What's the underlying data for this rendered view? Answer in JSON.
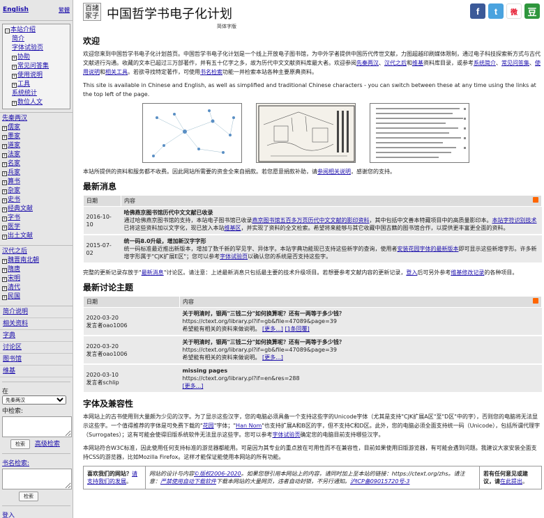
{
  "sidebar": {
    "lang_english": "English",
    "lang_traditional": "繁體",
    "intro": {
      "head": "本站介绍",
      "items": [
        "简介",
        "字体试验页",
        "协助",
        "常见问答集",
        "使用说明",
        "工具",
        "系统统计",
        "数位人文"
      ]
    },
    "pre_qin": {
      "head": "先秦两汉",
      "items": [
        "儒家",
        "墨家",
        "道家",
        "法家",
        "名家",
        "兵家",
        "算书",
        "杂家",
        "史书",
        "经典文献",
        "字书",
        "医学",
        "出土文献"
      ]
    },
    "post_han": {
      "head": "汉代之后",
      "items": [
        "魏晋南北朝",
        "隋唐",
        "宋明",
        "清代",
        "民国"
      ]
    },
    "links": [
      "简介说明",
      "相关资料",
      "字典",
      "讨论区",
      "图书馆",
      "维基"
    ],
    "search_select": "先秦两汉",
    "search_label_in": "在",
    "search_label": "中检索:",
    "search_button": "检索",
    "adv_search": "高级检索",
    "book_search_label": "书名检索:",
    "book_search_button": "检索",
    "login": "登入"
  },
  "header": {
    "logo": "百諸家子",
    "title": "中国哲学书电子化计划",
    "subtitle": "简体字版"
  },
  "social": [
    {
      "icon": "facebook-icon",
      "glyph": "f",
      "color": "#3b5998"
    },
    {
      "icon": "twitter-icon",
      "glyph": "t",
      "color": "#4aa3df"
    },
    {
      "icon": "weibo-icon",
      "glyph": "微",
      "color": "#e6162d"
    },
    {
      "icon": "douban-icon",
      "glyph": "豆",
      "color": "#2e963d"
    }
  ],
  "welcome": {
    "title": "欢迎",
    "p1_a": "欢迎您来到中国哲学书电子化计划首页。中国哲学书电子化计划是一个线上开放电子图书馆，为中外学者提供中国历代传世文献，力图超越印刷媒体限制，通过电子科技探索新方式与古代文献进行沟通。收藏的文本已超过三万部著作，并有五十亿字之多，故为历代中文文献资料库最大者。欢迎参阅",
    "l1": "先秦两汉",
    "l2": "汉代之后",
    "l3": "维基",
    "p1_b": "资料库目录，或参考",
    "l4": "系统简介",
    "l5": "常见问答集",
    "l6": "使用说明",
    "l7": "相关工具",
    "p1_c": "。若欲寻找特定著作，可使用",
    "l8": "书名检索",
    "p1_d": "功能一并检索本站各种主要原典资料。",
    "p2": "This site is available in Chinese and English, as well as simplified and traditional Chinese characters - you can switch between these at any time using the links at the top left of the page.",
    "p3_a": "本站所提供的资料和服务都不收费。因此网站所需要的资金全来自捐款。若您愿意捐款补助，请",
    "p3_link": "参阅相关说明",
    "p3_b": "，感谢您的支持。"
  },
  "news": {
    "title": "最新消息",
    "col_date": "日期",
    "col_content": "内容",
    "rows": [
      {
        "date": "2016-10-10",
        "headline": "哈佛燕京图书馆历代中文文献已收录",
        "body_a": "通过哈佛燕京图书馆的支持，本站电子图书馆已收录",
        "link1": "燕京图书馆五百多万页历代中文文献的影印资料",
        "body_b": "，其中包括中文善本特藏项目中的高质量影印本。",
        "link2": "本站字符识别技术",
        "body_c": "已将这些资料加以文字化，现已放入本站",
        "link3": "维基区",
        "body_d": "，并实现了资料的全文检索。希望将来能够与其它收藏中国古籍的图书馆合作，以提供更丰富更全面的资料。"
      },
      {
        "date": "2015-07-02",
        "headline": "统一码8.0升级，增加新汉字字形",
        "body_a": "统一码标准最近推出新版本，增加了数千新的罕见字、异体字。本站字典功能现已支持这些新字的查询，使用者",
        "link1": "安装花园字体的最新版本",
        "body_b": "即可显示这些新增字形。许多新增字形属于\"CJK扩展E区\"；您可以参考",
        "link2": "字体试验页",
        "body_c": "以确认您的系统是否支持这些字。"
      }
    ],
    "note_a": "完整的更新记录存放于\"",
    "note_link1": "最新消息",
    "note_b": "\"讨论区。请注意：上述最新消息只包括最主要的技术升级项目。若想要参考文献内容的更新记录，",
    "note_link2": "登入",
    "note_c": "后可另外参考",
    "note_link3": "维基修改记录",
    "note_d": "的各种项目。"
  },
  "discuss": {
    "title": "最新讨论主题",
    "col_date": "日期",
    "col_content": "内容",
    "rows": [
      {
        "date": "2020-03-20",
        "by": "发言者oao1006",
        "q": "关于明清时，银两\"三钱二分\"如何换算呢？还有一两等于多少钱？",
        "url": "https://ctext.org/library.pl?if=gb&file=47089&page=39",
        "note": "希望能有相关的资料来做说明。",
        "more": "[更多...]",
        "count": "[1条回覆]"
      },
      {
        "date": "2020-03-20",
        "by": "发言者oao1006",
        "q": "关于明清时，银两\"三钱二分\"如何换算呢？还有一两等于多少钱？",
        "url": "https://ctext.org/library.pl?if=gb&file=47089&page=39",
        "note": "希望能有相关的资料来做说明。",
        "more": "[更多...]",
        "count": ""
      },
      {
        "date": "2020-03-10",
        "by": "发言者schlip",
        "q": "missing pages",
        "url": "https://ctext.org/library.pl?if=en&res=288",
        "note": "",
        "more": "[更多...]",
        "count": ""
      }
    ]
  },
  "fonts": {
    "title": "字体及兼容性",
    "p1_a": "本网站上的古书使用到大量颇为少见的汉字。为了显示这些汉字，您的电脑必须具备一个支持这些字的Unicode字体（尤其是支持\"CJK扩展A区\"至\"D区\"中的字），否则您的电脑将无法显示这些字。一个值得推荐的字体是可免费下载的\"",
    "l1": "花园",
    "p1_b": "\"字体；\"",
    "l2": "Han Nom",
    "p1_c": "\"也支持扩展A和B区的字，但不支持C和D区。此外，您的电脑必须全面支持统一码（Unicode），包括所谓代理字（Surrogates）；这有可能会使得旧版系统软件无法显示这些字。您可以参考",
    "l3": "字体试验页",
    "p1_d": "确定您的电脑目前支持哪些汉字。",
    "p2": "本网站符合W3C标准，因此使用任何支持标准的游览器都能用。可是因为其专业的重点放在可用性而不在兼容性，目前如果使用旧版游览器，有可能会遇到问题。我建议大家安装全面支持CSS的游览器，比如Mozilla Firefox。这样才能保证能使用本网站的所有功能。"
  },
  "footer": {
    "left_a": "喜欢我们的网站？",
    "left_link": "请支持我们的发展",
    "left_b": "。",
    "mid_a": "网站的设计与内容",
    "mid_link1": "©版权2006-2020",
    "mid_b": "。如果您想引用本网站上的内容，请同时加上至本站的链接：https://ctext.org/zhs。请注意：",
    "mid_link2": "严禁使用自动下载软件",
    "mid_c": "下载本网站的大量网页，违者自动封锁，不另行通知。",
    "mid_link3": "沪ICP备09015720号-3",
    "right_a": "若有任何意见或建议，请",
    "right_link": "在此提出",
    "right_b": "。"
  }
}
